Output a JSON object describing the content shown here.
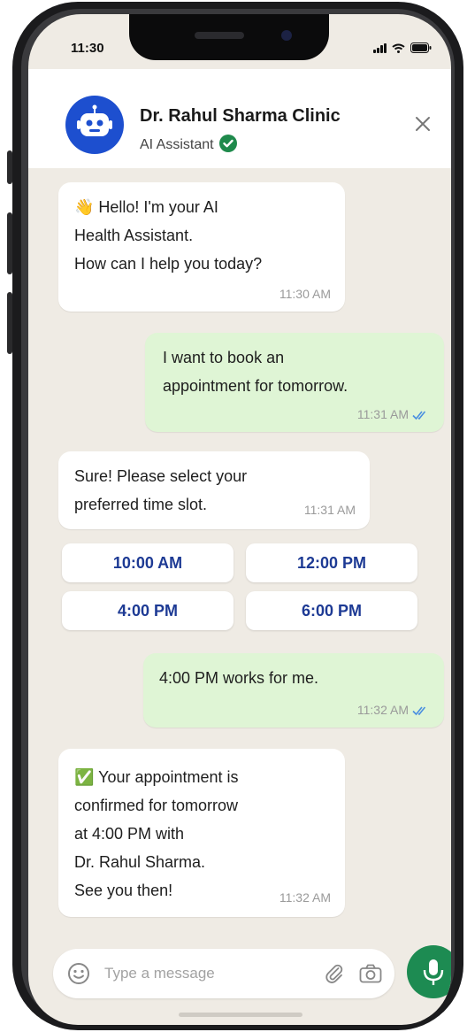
{
  "status_bar": {
    "time": "11:30"
  },
  "header": {
    "name": "Dr. Rahul Sharma Clinic",
    "subtitle": "AI Assistant",
    "avatar_icon": "robot-icon",
    "verified_icon": "verified-check-icon",
    "close_icon": "close-icon"
  },
  "messages": [
    {
      "from": "bot",
      "lines": [
        "👋 Hello! I'm your AI",
        "Health Assistant.",
        "How can I help you today?"
      ],
      "time": "11:30 AM"
    },
    {
      "from": "user",
      "lines": [
        "I want to book an",
        "appointment for tomorrow."
      ],
      "time": "11:31 AM",
      "status": "read"
    },
    {
      "from": "bot",
      "lines": [
        "Sure! Please select your",
        "preferred time slot."
      ],
      "time": "11:31 AM"
    },
    {
      "from": "user",
      "lines": [
        "4:00 PM works for me."
      ],
      "time": "11:32 AM",
      "status": "read"
    },
    {
      "from": "bot",
      "lines": [
        "✅ Your appointment is",
        "confirmed for tomorrow",
        "at 4:00 PM with",
        "Dr. Rahul Sharma.",
        "See you then!"
      ],
      "time": "11:32 AM"
    }
  ],
  "time_slots": [
    "10:00 AM",
    "12:00 PM",
    "4:00 PM",
    "6:00 PM"
  ],
  "input": {
    "placeholder": "Type a message",
    "emoji_icon": "emoji-icon",
    "attach_icon": "paperclip-icon",
    "camera_icon": "camera-icon",
    "mic_icon": "microphone-icon"
  },
  "colors": {
    "accent": "#1d8b52",
    "avatar": "#1d4fcf",
    "outgoing_bubble": "#dff5d5",
    "chat_background": "#efebe4",
    "slot_text": "#1d3a94",
    "read_ticks": "#4a8fe0"
  }
}
